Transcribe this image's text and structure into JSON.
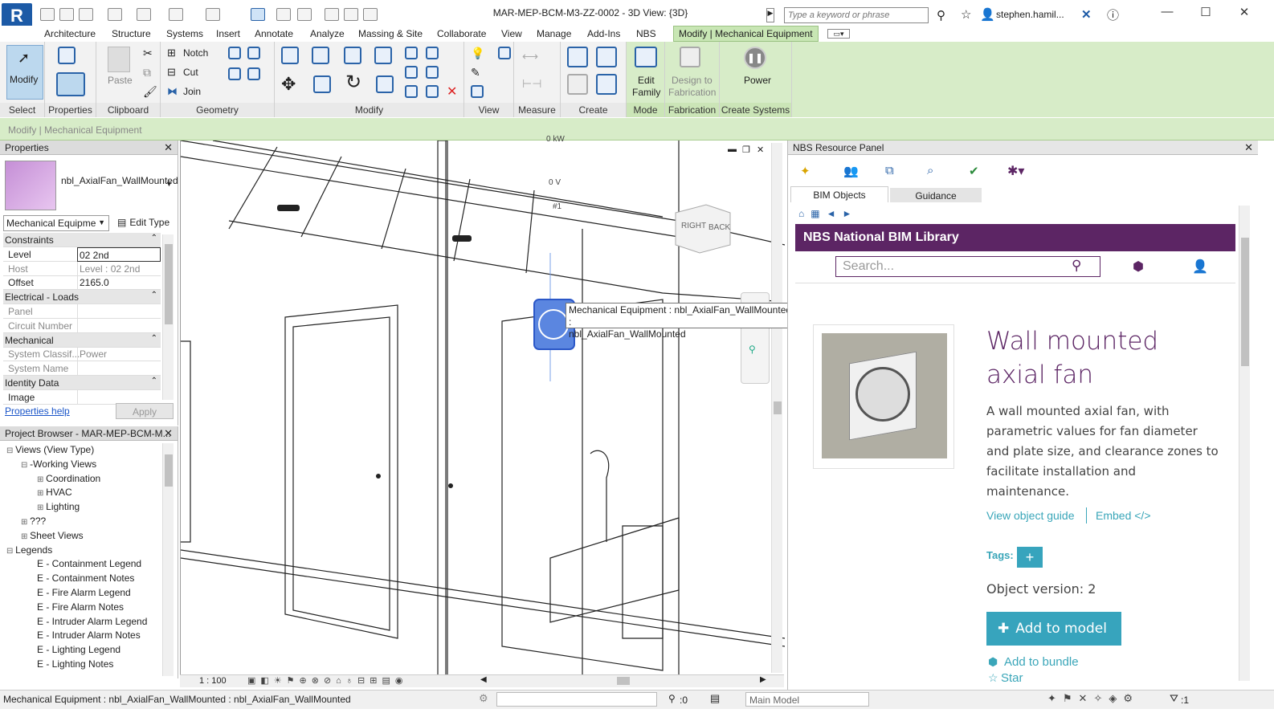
{
  "app": {
    "logo_letter": "R",
    "title": "MAR-MEP-BCM-M3-ZZ-0002 - 3D View: {3D}",
    "search_placeholder": "Type a keyword or phrase",
    "user": "stephen.hamil..."
  },
  "ribbon": {
    "tabs": [
      "Architecture",
      "Structure",
      "Systems",
      "Insert",
      "Annotate",
      "Analyze",
      "Massing & Site",
      "Collaborate",
      "View",
      "Manage",
      "Add-Ins",
      "NBS"
    ],
    "active_tab": "Modify | Mechanical Equipment",
    "modify_label": "Modify",
    "panels": {
      "select": "Select",
      "properties": "Properties",
      "clipboard": "Clipboard",
      "geometry": "Geometry",
      "modify": "Modify",
      "view": "View",
      "measure": "Measure",
      "create": "Create",
      "mode": "Mode",
      "fabrication": "Fabrication",
      "create_systems": "Create Systems"
    },
    "buttons": {
      "paste": "Paste",
      "notch": "Notch",
      "cut": "Cut",
      "join": "Join",
      "edit_family_1": "Edit",
      "edit_family_2": "Family",
      "design_fab_1": "Design to",
      "design_fab_2": "Fabrication",
      "power": "Power"
    }
  },
  "context_bar": "Modify | Mechanical Equipment",
  "properties": {
    "title": "Properties",
    "type_name": "nbl_AxialFan_WallMounted",
    "category": "Mechanical Equipme",
    "edit_type": "Edit Type",
    "rows": [
      {
        "group": true,
        "label": "Constraints"
      },
      {
        "label": "Level",
        "value": "02 2nd"
      },
      {
        "label": "Host",
        "value": "Level : 02 2nd"
      },
      {
        "label": "Offset",
        "value": "2165.0"
      },
      {
        "group": true,
        "label": "Electrical - Loads"
      },
      {
        "label": "Panel",
        "value": ""
      },
      {
        "label": "Circuit Number",
        "value": ""
      },
      {
        "group": true,
        "label": "Mechanical"
      },
      {
        "label": "System Classif...",
        "value": "Power"
      },
      {
        "label": "System Name",
        "value": ""
      },
      {
        "group": true,
        "label": "Identity Data"
      },
      {
        "label": "Image",
        "value": ""
      }
    ],
    "help": "Properties help",
    "apply": "Apply"
  },
  "browser": {
    "title": "Project Browser - MAR-MEP-BCM-M...",
    "items": [
      {
        "text": "Views (View Type)",
        "indent": 0
      },
      {
        "text": "-Working Views",
        "indent": 1
      },
      {
        "text": "Coordination",
        "indent": 2
      },
      {
        "text": "HVAC",
        "indent": 2
      },
      {
        "text": "Lighting",
        "indent": 2
      },
      {
        "text": "???",
        "indent": 1
      },
      {
        "text": "Sheet Views",
        "indent": 1
      },
      {
        "text": "Legends",
        "indent": 0
      },
      {
        "text": "E - Containment Legend",
        "indent": 3
      },
      {
        "text": "E - Containment Notes",
        "indent": 3
      },
      {
        "text": "E - Fire Alarm Legend",
        "indent": 3
      },
      {
        "text": "E - Fire Alarm Notes",
        "indent": 3
      },
      {
        "text": "E - Intruder Alarm Legend",
        "indent": 3
      },
      {
        "text": "E - Intruder Alarm Notes",
        "indent": 3
      },
      {
        "text": "E - Lighting Legend",
        "indent": 3
      },
      {
        "text": "E - Lighting Notes",
        "indent": 3
      }
    ]
  },
  "canvas": {
    "annotations": [
      "0 kW",
      "0 V",
      "#1"
    ],
    "viewcube_right": "RIGHT",
    "viewcube_back": "BACK",
    "tooltip_1": "Mechanical Equipment : nbl_AxialFan_WallMounted :",
    "tooltip_2": "nbl_AxialFan_WallMounted",
    "scale": "1 : 100"
  },
  "nbs": {
    "panel_title": "NBS Resource Panel",
    "tab_objects": "BIM Objects",
    "tab_guidance": "Guidance",
    "header": "NBS National BIM Library",
    "search_placeholder": "Search...",
    "product_title": "Wall mounted axial fan",
    "description": "A wall mounted axial fan, with parametric values for fan diameter and plate size, and clearance zones to facilitate installation and maintenance.",
    "view_guide": "View object guide",
    "embed": "Embed </>",
    "tags_label": "Tags:",
    "tags_plus": "+",
    "version": "Object version: 2",
    "add_to_model": "Add to model",
    "add_to_bundle": "Add to bundle",
    "star": "Star"
  },
  "status": {
    "text": "Mechanical Equipment : nbl_AxialFan_WallMounted : nbl_AxialFan_WallMounted",
    "filter_count": ":0",
    "main_model": "Main Model",
    "selection": ":1"
  }
}
